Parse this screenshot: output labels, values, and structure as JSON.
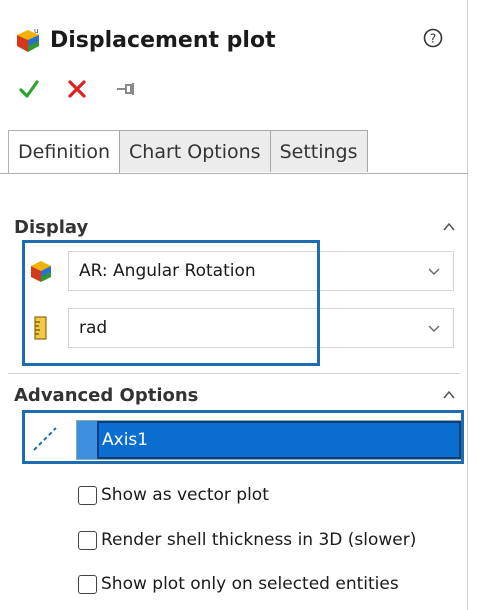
{
  "header": {
    "title": "Displacement plot",
    "icon": "displacement-plot-icon",
    "help_icon": "help-icon"
  },
  "actions": {
    "ok_icon": "check-icon",
    "cancel_icon": "close-icon",
    "pin_icon": "pin-icon"
  },
  "tabs": [
    {
      "label": "Definition",
      "active": true
    },
    {
      "label": "Chart Options",
      "active": false
    },
    {
      "label": "Settings",
      "active": false
    }
  ],
  "display": {
    "title": "Display",
    "component": {
      "value": "AR: Angular Rotation",
      "icon": "result-component-icon"
    },
    "units": {
      "value": "rad",
      "icon": "ruler-icon"
    }
  },
  "advanced": {
    "title": "Advanced Options",
    "axis": {
      "value": "Axis1",
      "icon": "axis-icon"
    },
    "options": [
      {
        "label": "Show as vector plot",
        "checked": false
      },
      {
        "label": "Render shell thickness in 3D (slower)",
        "checked": false
      },
      {
        "label": "Show plot only on selected entities",
        "checked": false
      }
    ]
  },
  "colors": {
    "accent": "#1b6cb0",
    "selection": "#0a6ed1",
    "ok": "#2aa52a",
    "cancel": "#e02020"
  }
}
